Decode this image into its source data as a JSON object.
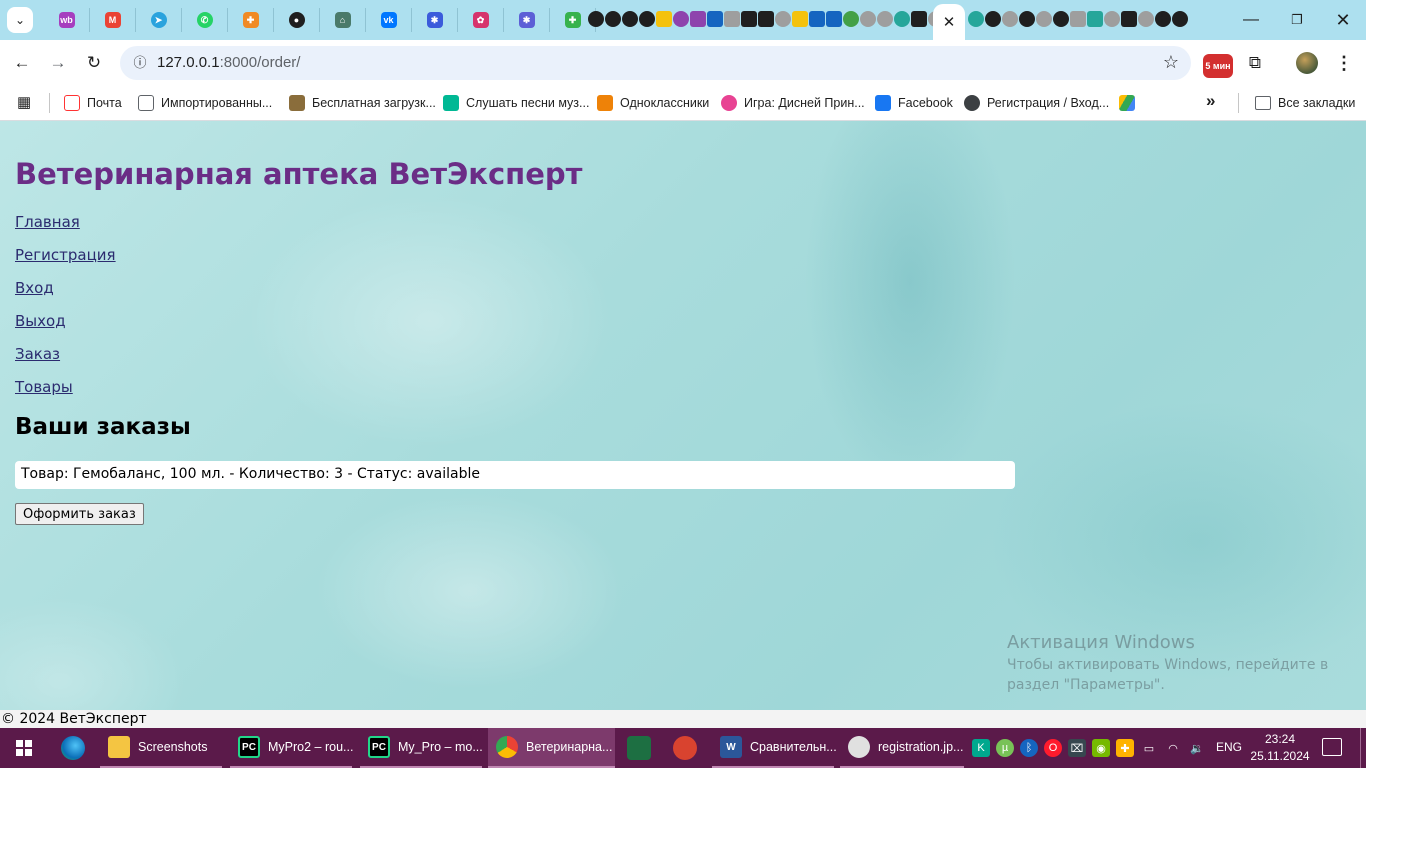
{
  "browser": {
    "active_tab_close": "✕",
    "new_tab": "+",
    "window_minimize": "—",
    "window_maximize": "❐",
    "window_close": "✕",
    "url_host": "127.0.0.1",
    "url_path": ":8000/order/",
    "extension_badge_text": "5 мин",
    "bookmarks": [
      {
        "label": "Почта",
        "icon": "yandex-icon",
        "color": "#ff3333"
      },
      {
        "label": "Импортированны...",
        "icon": "folder-icon",
        "color": "#5f6368"
      },
      {
        "label": "Бесплатная загрузк...",
        "icon": "site-icon",
        "color": "#8a6d3b"
      },
      {
        "label": "Слушать песни муз...",
        "icon": "play-icon",
        "color": "#00b894"
      },
      {
        "label": "Одноклассники",
        "icon": "ok-icon",
        "color": "#ee8208"
      },
      {
        "label": "Игра: Дисней Прин...",
        "icon": "heart-icon",
        "color": "#e84393"
      },
      {
        "label": "Facebook",
        "icon": "facebook-icon",
        "color": "#1877f2"
      },
      {
        "label": "Регистрация / Вход...",
        "icon": "globe-icon",
        "color": "#3c4043"
      },
      {
        "label": "",
        "icon": "drive-icon",
        "color": "#34a853"
      }
    ],
    "all_bookmarks_label": "Все закладки"
  },
  "page": {
    "title": "Ветеринарная аптека ВетЭксперт",
    "nav": [
      "Главная",
      "Регистрация",
      "Вход",
      "Выход",
      "Заказ",
      "Товары"
    ],
    "orders_heading": "Ваши заказы",
    "order_item": "Товар: Гемобаланс, 100 мл. - Количество: 3 - Статус: available",
    "submit_button": "Оформить заказ",
    "footer": "© 2024 ВетЭксперт"
  },
  "activation": {
    "title": "Активация Windows",
    "text": "Чтобы активировать Windows, перейдите в раздел \"Параметры\"."
  },
  "taskbar": {
    "items": [
      {
        "label": "Screenshots",
        "icon": "folder-icon",
        "color": "#f4c542"
      },
      {
        "label": "MyPro2 – rou...",
        "icon": "pycharm-icon",
        "color": "#21d789"
      },
      {
        "label": "My_Pro – mo...",
        "icon": "pycharm-icon",
        "color": "#21d789"
      },
      {
        "label": "Ветеринарна...",
        "icon": "chrome-icon",
        "color": "#4285f4"
      },
      {
        "label": "Сравнительн...",
        "icon": "word-icon",
        "color": "#2b579a"
      },
      {
        "label": "registration.jp...",
        "icon": "paint-icon",
        "color": "#e0e0e0"
      }
    ],
    "language": "ENG",
    "time": "23:24",
    "date": "25.11.2024"
  }
}
